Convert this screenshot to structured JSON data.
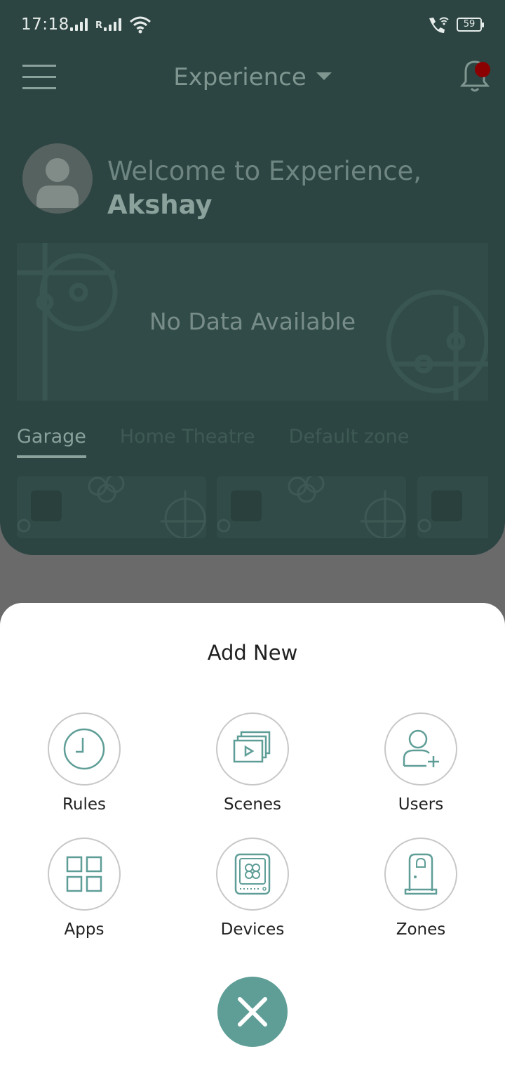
{
  "status_bar": {
    "time": "17:18",
    "network_label": "R",
    "battery": "59"
  },
  "header": {
    "title": "Experience"
  },
  "welcome": {
    "greeting": "Welcome to Experience,",
    "user_name": "Akshay"
  },
  "panel": {
    "empty_message": "No Data Available"
  },
  "zone_tabs": [
    {
      "label": "Garage",
      "active": true
    },
    {
      "label": "Home Theatre",
      "active": false
    },
    {
      "label": "Default zone",
      "active": false
    }
  ],
  "sheet": {
    "title": "Add New",
    "options": [
      {
        "label": "Rules",
        "icon": "clock-icon"
      },
      {
        "label": "Scenes",
        "icon": "scenes-icon"
      },
      {
        "label": "Users",
        "icon": "add-user-icon"
      },
      {
        "label": "Apps",
        "icon": "grid-icon"
      },
      {
        "label": "Devices",
        "icon": "device-icon"
      },
      {
        "label": "Zones",
        "icon": "door-icon"
      }
    ],
    "close_icon": "close-icon"
  },
  "colors": {
    "accent": "#5f9e97",
    "card_bg": "#2c4542",
    "sheet_bg": "#ffffff",
    "notification_dot": "#8b0000"
  }
}
